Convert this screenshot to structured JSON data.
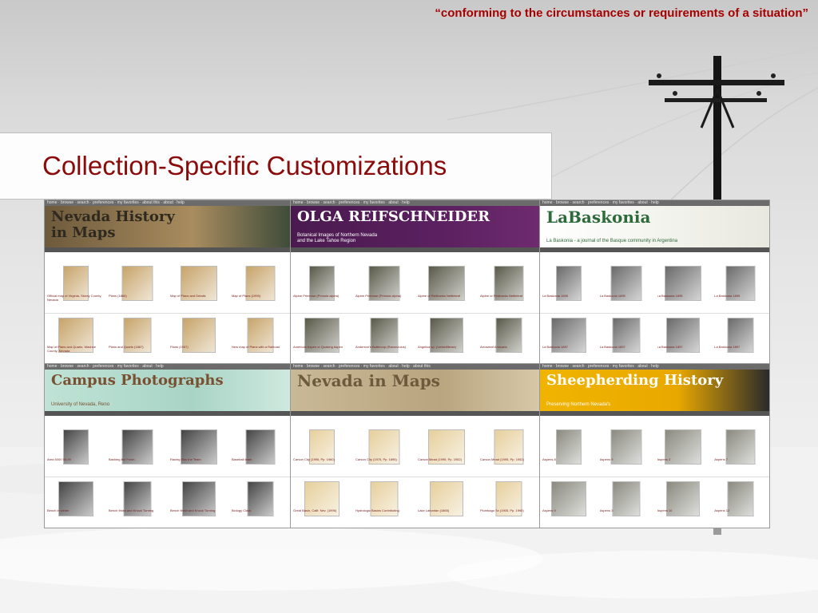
{
  "quote": "“conforming to the circumstances or requirements of a situation”",
  "title": "Collection-Specific Customizations",
  "screenshots": [
    {
      "id": "nevada-history-in-maps",
      "banner_title": "Nevada History\nin Maps",
      "banner_colors": [
        "#6d5a3c",
        "#a98c5f",
        "#3e4b3a"
      ],
      "nav": "home · browse · search · preferences · my favorites · about this · about · help",
      "title_color": "#2f2a1f",
      "thumb_color": "#c7a46a",
      "captions": [
        "Official map of Virginia, Storey County, Nevada",
        "Plans (1866)",
        "Map of Plans and Details",
        "Map of Plans (1995)",
        "Map of Plans and Quartz, Washoe County, Nevada",
        "Plans and Quarts (1867)",
        "Plans (1957)",
        "New map of Plans with a Railroad"
      ]
    },
    {
      "id": "olga-reifschneider",
      "banner_title": "OLGA REIFSCHNEIDER",
      "banner_sub": "Botanical Images of Northern Nevada\nand the Lake Tahoe Region",
      "banner_colors": [
        "#4a1a4f",
        "#5b2060",
        "#6e2b6f"
      ],
      "nav": "home · browse · search · preferences · my favorites · about · help",
      "title_color": "#ffffff",
      "thumb_color": "#5a5a4a",
      "captions": [
        "Alpine Primrose (Primula alpina)",
        "Alpine Primrose (Primula alpina)",
        "Alpine or Redbanks Nettleleaf",
        "Alpine or Redbanks Nettleleaf",
        "American Aspen or Quaking Aspen",
        "Anderson's Buttercup (Ranunculus)",
        "Angelica sp. (Umbelliferae)",
        "Arrowleaf Arnicaria"
      ]
    },
    {
      "id": "la-baskonia",
      "banner_title": "LaBaskonia",
      "banner_sub": "La Baskonia - a journal of the Basque community in Argentina",
      "banner_colors": [
        "#ffffff",
        "#f2f2ec",
        "#e8e8df"
      ],
      "nav": "home · browse · search · preferences · my favorites · about · help",
      "title_color": "#2d6a3a",
      "thumb_color": "#6a6a6a",
      "captions": [
        "La Baskonia 1895",
        "La Baskonia 1895",
        "La Baskonia 1895",
        "La Baskonia 1895",
        "La Baskonia 1897",
        "La Baskonia 1897",
        "La Baskonia 1897",
        "La Baskonia 1897"
      ]
    },
    {
      "id": "campus-photographs",
      "banner_title": "Campus Photographs",
      "banner_sub": "University of Nevada, Reno",
      "banner_colors": [
        "#bfe3d6",
        "#a8d4c6",
        "#cfe9df"
      ],
      "nav": "home · browse · search · preferences · my favorites · about · help",
      "title_color": "#7a5030",
      "thumb_color": "#444444",
      "captions": [
        "Area 5000 95-99",
        "Bashing the Frosh",
        "Racing Elks the Team",
        "Baseball team",
        "Bench in winter",
        "Bench finish and Knock Turning",
        "Bench finish and Knock Turning",
        "Biology Class"
      ]
    },
    {
      "id": "nevada-in-maps",
      "banner_title": "Nevada in Maps",
      "banner_colors": [
        "#c9b896",
        "#b9a57f",
        "#d7c8a9"
      ],
      "nav": "home · browse · search · preferences · my favorites · about · help · about this",
      "title_color": "#6d5a3c",
      "thumb_color": "#e6cf9c",
      "captions": [
        "Carson City (1995, Pp. 1960)",
        "Carson City (1975, Pp. 1895)",
        "Carson Mead (1995, Pp. 1952)",
        "Carson Mead (1995, Pp. 1952)",
        "Great Basin, Calif. Nev. (1996)",
        "Hydrologic Basins Contributing",
        "Lake Lahontan (1865)",
        "Plumbago Sx (1905, Pp. 1990)"
      ]
    },
    {
      "id": "sheepherding-history",
      "banner_title": "Sheepherding History",
      "banner_sub": "Preserving Northern Nevada's",
      "banner_colors": [
        "#f0b400",
        "#e9a800",
        "#2a2a2a"
      ],
      "nav": "home · browse · search · preferences · my favorites · about · help",
      "title_color": "#ffffff",
      "thumb_color": "#8a8a80",
      "captions": [
        "Aspens 8",
        "Aspens 9",
        "Aspens 3",
        "Aspens 7",
        "Aspens 9",
        "Aspens 3",
        "Aspens 10",
        "Aspens 12"
      ]
    }
  ]
}
